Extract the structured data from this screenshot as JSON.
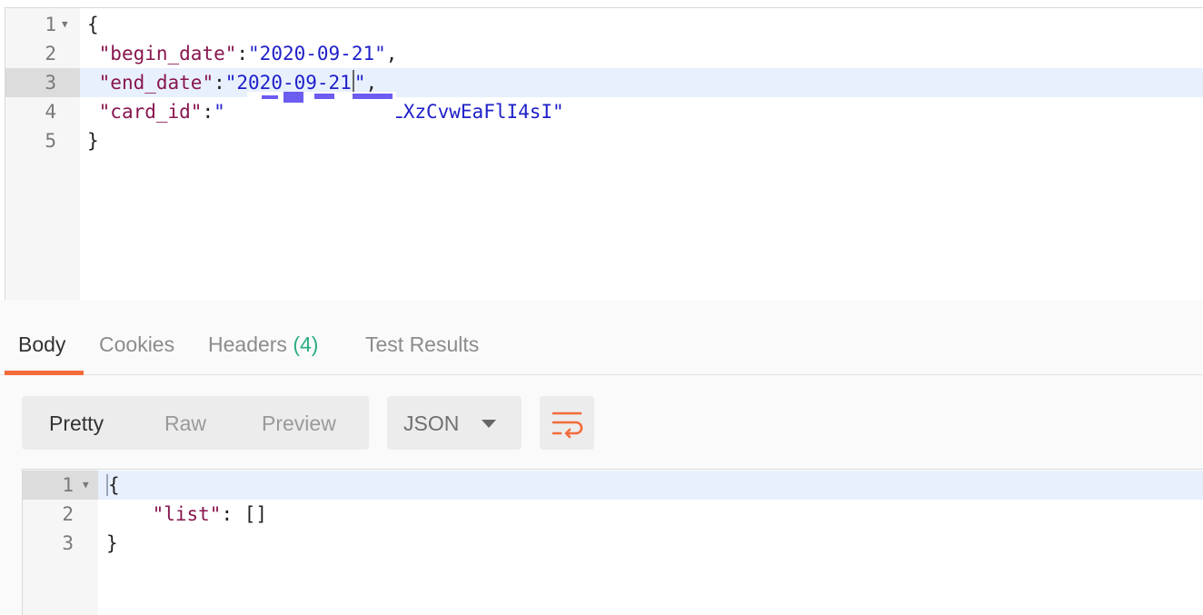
{
  "request": {
    "lines": [
      {
        "num": "1",
        "text": "{"
      },
      {
        "num": "2",
        "key": "\"begin_date\"",
        "sep": ":",
        "value": "\"2020-09-21\"",
        "end": ","
      },
      {
        "num": "3",
        "key": "\"end_date\"",
        "sep": ":",
        "value": "\"2020-09-21",
        "value_end": "\"",
        "end": ","
      },
      {
        "num": "4",
        "key": "\"card_id\"",
        "sep": ":",
        "value_visible": "lXLXzCvwEaFlI4sI\"",
        "value_start": "\""
      },
      {
        "num": "5",
        "text": "}"
      }
    ],
    "fold_icon": "chevron-down-icon"
  },
  "response_tabs": {
    "body": "Body",
    "cookies": "Cookies",
    "headers": "Headers",
    "headers_count": "(4)",
    "test_results": "Test Results"
  },
  "toolbar": {
    "pretty": "Pretty",
    "raw": "Raw",
    "preview": "Preview",
    "format": "JSON",
    "wrap_icon": "wrap-lines-icon"
  },
  "response": {
    "lines": [
      {
        "num": "1",
        "text": "{"
      },
      {
        "num": "2",
        "key": "\"list\"",
        "sep": ": ",
        "value": "[]"
      },
      {
        "num": "3",
        "text": "}"
      }
    ]
  },
  "colors": {
    "accent": "#f26b3a",
    "json_key": "#88164f",
    "json_string": "#1f20c8",
    "count_green": "#2bae84",
    "active_line": "#e8f0fd"
  }
}
